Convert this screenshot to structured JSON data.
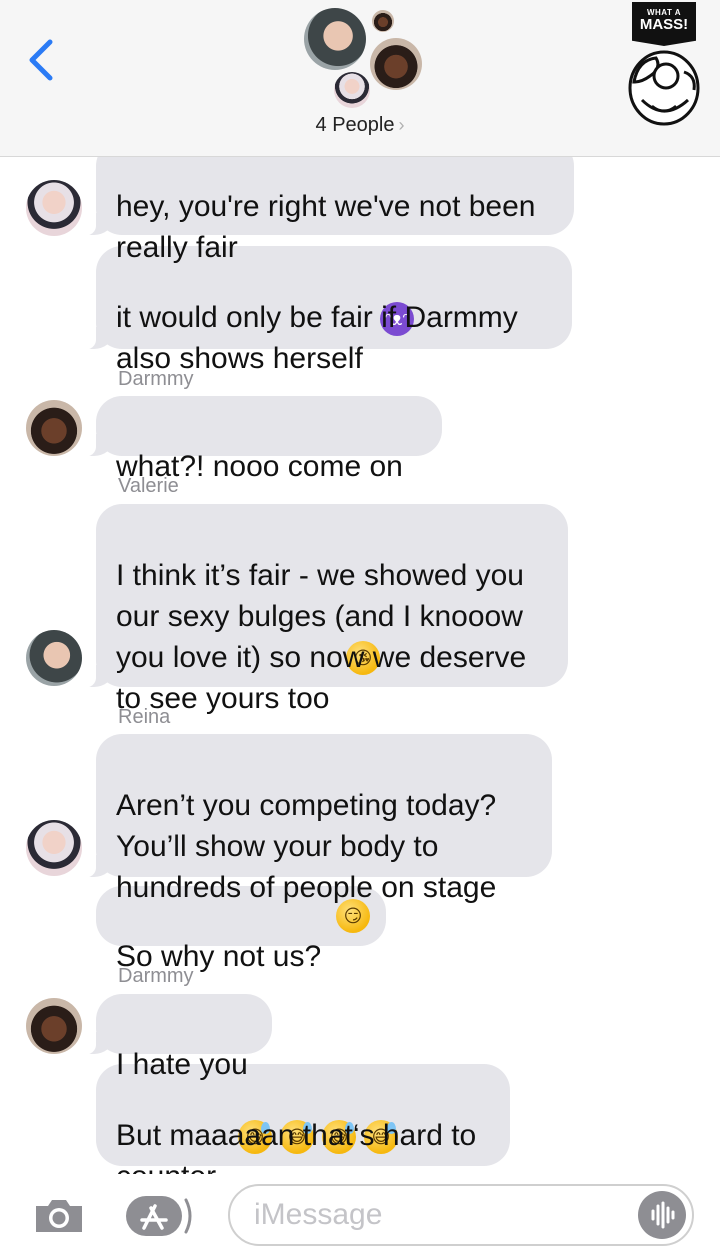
{
  "header": {
    "group_label": "4 People",
    "chevron": "›",
    "back_icon": "chevron-left-icon",
    "accent": "#2b7bf5",
    "logo": {
      "small": "WHAT A",
      "big": "MASS!"
    }
  },
  "messages": [
    {
      "lines": "hey, you're right we've not been\nreally fair",
      "avatar": "reina"
    },
    {
      "lines": "it would only be fair if Darmmy\nalso shows herself",
      "emoji": [
        "devil-emoji"
      ]
    },
    {
      "sender": "Darmmy",
      "lines": "what?! nooo come on",
      "avatar": "darmmy"
    },
    {
      "sender": "Valerie",
      "lines": "I think it’s fair - we showed you\nour sexy bulges (and I knooow\nyou love it) so now we deserve\nto see yours too",
      "emoji": [
        "kissing-heart-emoji"
      ],
      "avatar": "valerie"
    },
    {
      "sender": "Reina",
      "lines": "Aren’t you competing today?\nYou’ll show your body to\nhundreds of people on stage",
      "avatar": "reina"
    },
    {
      "lines": "So why not us?",
      "emoji": [
        "smirk-emoji"
      ]
    },
    {
      "sender": "Darmmy",
      "lines": "I hate you",
      "avatar": "darmmy"
    },
    {
      "lines": "But maaaaan that‘s hard to\ncounter",
      "emoji": [
        "sweat-smile-emoji",
        "sweat-smile-emoji",
        "sweat-smile-emoji",
        "sweat-smile-emoji"
      ]
    }
  ],
  "input": {
    "placeholder": "iMessage",
    "camera_icon": "camera-icon",
    "apps_icon": "app-store-icon",
    "audio_icon": "audio-waveform-icon"
  },
  "colors": {
    "bubble": "#e5e5ea",
    "sender_text": "#8e8e93",
    "header_bg": "#f6f6f6"
  }
}
